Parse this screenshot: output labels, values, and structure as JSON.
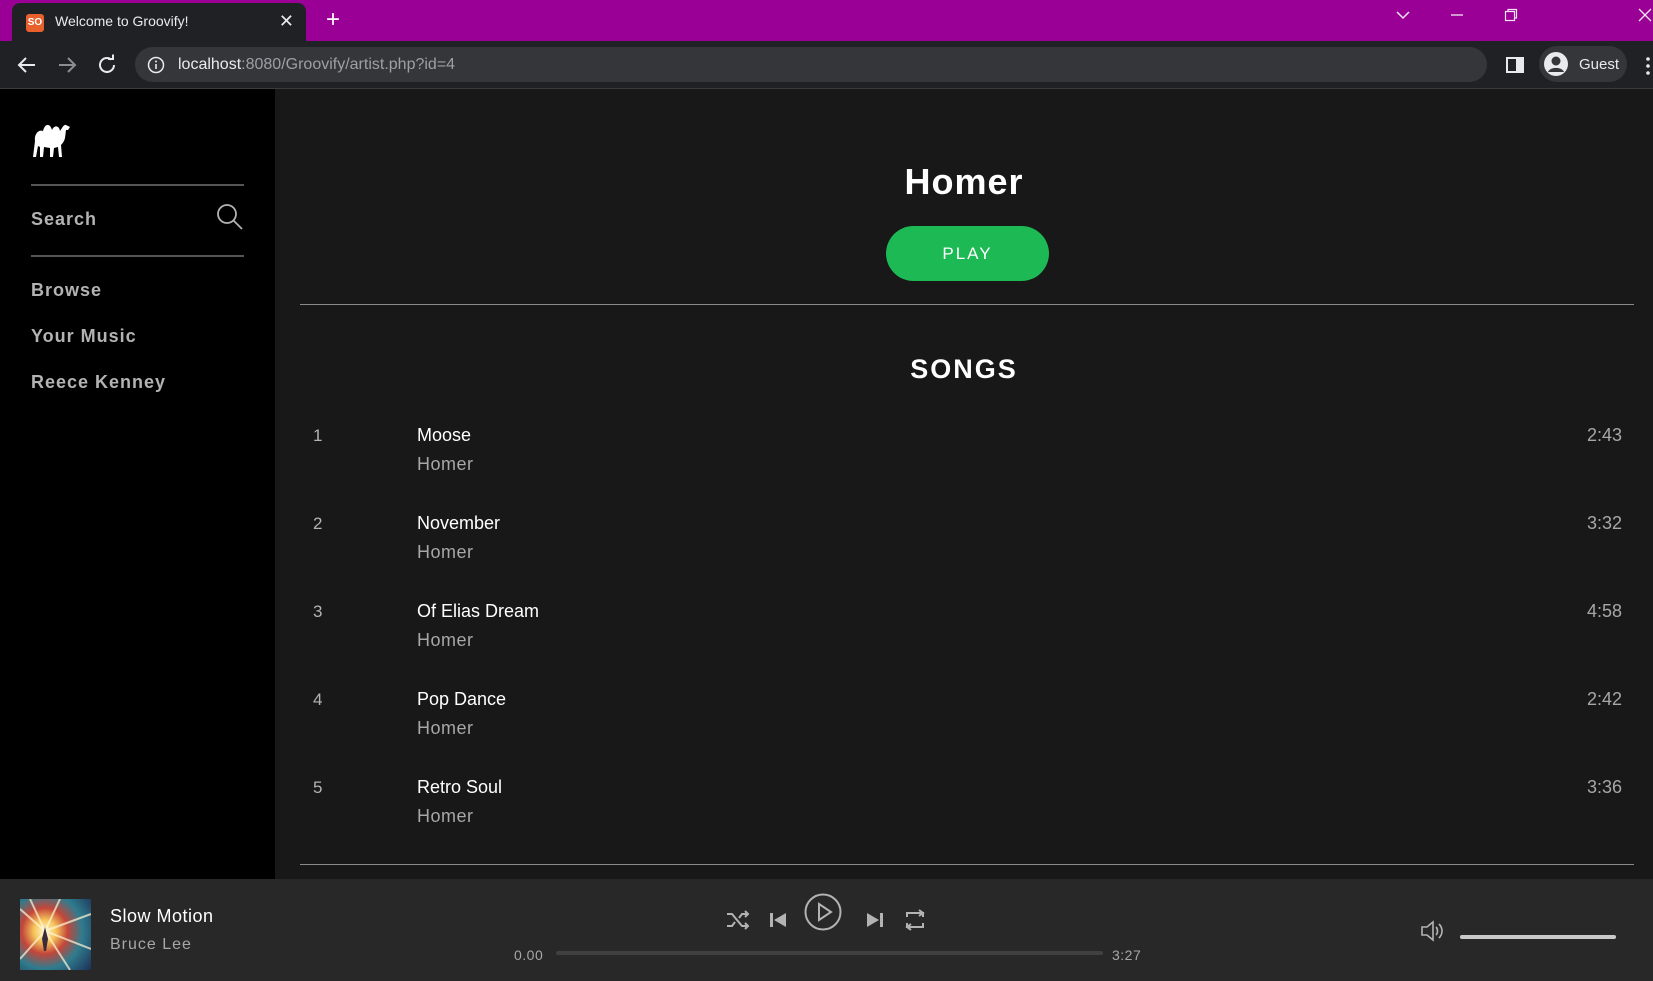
{
  "browser": {
    "tab_title": "Welcome to Groovify!",
    "favicon_text": "SO",
    "close_glyph": "✕",
    "new_tab_glyph": "+",
    "url_host": "localhost",
    "url_rest": ":8080/Groovify/artist.php?id=4",
    "profile_name": "Guest"
  },
  "sidebar": {
    "search_label": "Search",
    "items": [
      {
        "label": "Browse"
      },
      {
        "label": "Your Music"
      },
      {
        "label": "Reece Kenney"
      }
    ]
  },
  "artist": {
    "name": "Homer",
    "play_label": "PLAY"
  },
  "songs": {
    "heading": "SONGS",
    "tracks": [
      {
        "num": "1",
        "title": "Moose",
        "artist": "Homer",
        "duration": "2:43"
      },
      {
        "num": "2",
        "title": "November",
        "artist": "Homer",
        "duration": "3:32"
      },
      {
        "num": "3",
        "title": "Of Elias Dream",
        "artist": "Homer",
        "duration": "4:58"
      },
      {
        "num": "4",
        "title": "Pop Dance",
        "artist": "Homer",
        "duration": "2:42"
      },
      {
        "num": "5",
        "title": "Retro Soul",
        "artist": "Homer",
        "duration": "3:36"
      }
    ]
  },
  "player": {
    "title": "Slow Motion",
    "artist": "Bruce Lee",
    "current_time": "0.00",
    "total_time": "3:27",
    "progress_fraction": 0,
    "volume_fraction": 1
  },
  "colors": {
    "accent": "#1db954",
    "titlebar": "#9b0096",
    "sidebar_bg": "#000000",
    "main_bg": "#181818",
    "player_bg": "#282828"
  }
}
